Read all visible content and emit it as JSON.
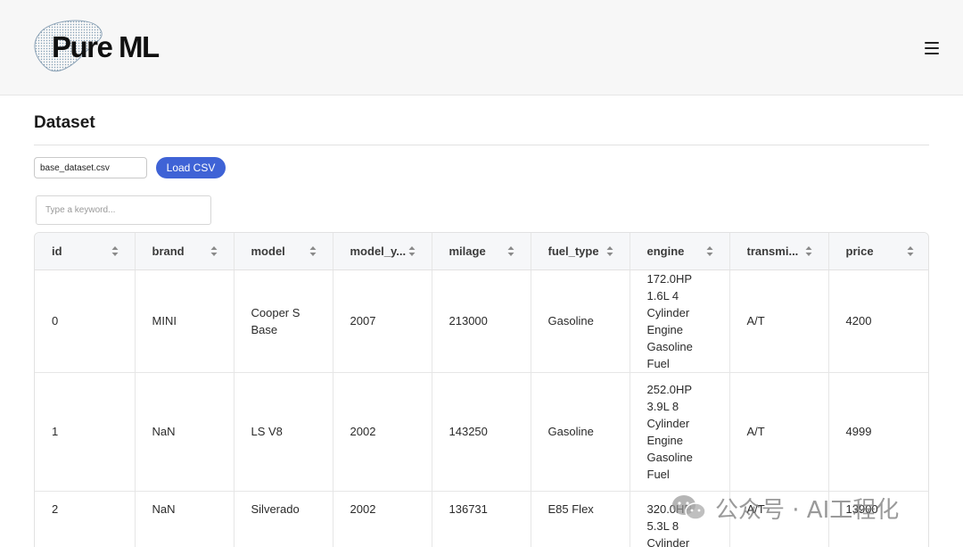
{
  "header": {
    "logo_text": "Pure ML",
    "menu_icon": "hamburger-menu-icon"
  },
  "main": {
    "title": "Dataset",
    "file_input_value": "base_dataset.csv",
    "load_button_label": "Load CSV",
    "search_placeholder": "Type a keyword...",
    "table": {
      "columns": [
        "id",
        "brand",
        "model",
        "model_y...",
        "milage",
        "fuel_type",
        "engine",
        "transmi...",
        "price"
      ],
      "rows": [
        [
          "0",
          "MINI",
          "Cooper S Base",
          "2007",
          "213000",
          "Gasoline",
          "172.0HP 1.6L 4 Cylinder Engine Gasoline Fuel",
          "A/T",
          "4200"
        ],
        [
          "1",
          "NaN",
          "LS V8",
          "2002",
          "143250",
          "Gasoline",
          "252.0HP 3.9L 8 Cylinder Engine Gasoline Fuel",
          "A/T",
          "4999"
        ],
        [
          "2",
          "NaN",
          "Silverado",
          "2002",
          "136731",
          "E85 Flex",
          "320.0HP 5.3L 8 Cylinder",
          "A/T",
          "13900"
        ]
      ]
    }
  },
  "watermark": {
    "text": "公众号 · AI工程化",
    "icon": "wechat-icon"
  },
  "colors": {
    "header_bg": "#f7f7f7",
    "accent": "#3f63d6",
    "table_header_bg": "#f6f7f9"
  }
}
